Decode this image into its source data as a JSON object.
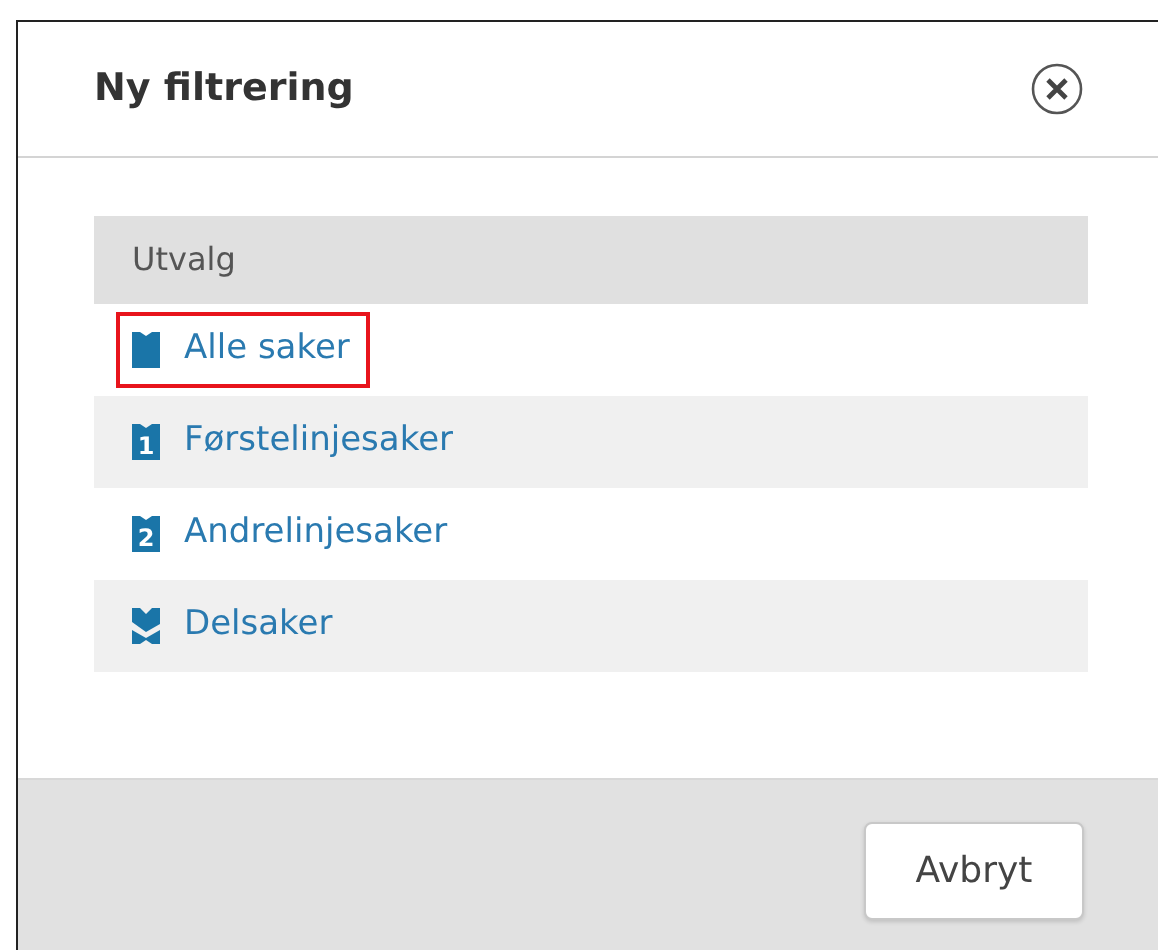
{
  "dialog": {
    "title": "Ny filtrering"
  },
  "list": {
    "header": "Utvalg",
    "items": [
      {
        "label": "Alle saker",
        "kind": "all",
        "highlighted": true
      },
      {
        "label": "Førstelinjesaker",
        "kind": "numbered",
        "icon_text": "1",
        "highlighted": false
      },
      {
        "label": "Andrelinjesaker",
        "kind": "numbered",
        "icon_text": "2",
        "highlighted": false
      },
      {
        "label": "Delsaker",
        "kind": "sub",
        "highlighted": false
      }
    ]
  },
  "buttons": [
    {
      "label": "Avbryt"
    }
  ]
}
